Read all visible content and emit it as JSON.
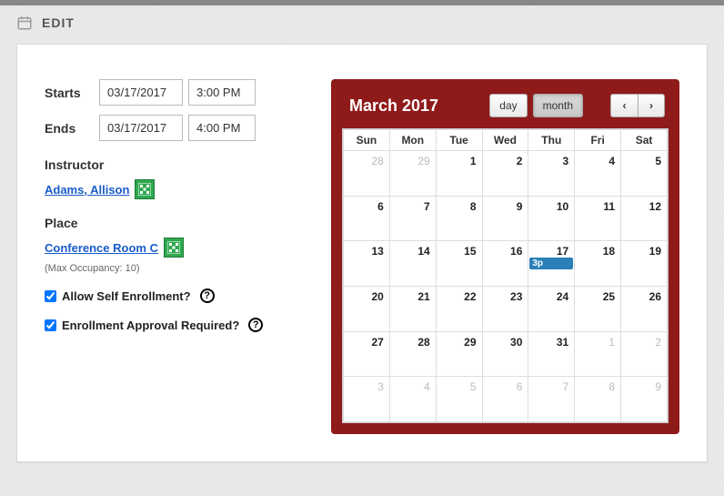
{
  "page": {
    "title": "EDIT"
  },
  "form": {
    "starts_label": "Starts",
    "ends_label": "Ends",
    "start_date": "03/17/2017",
    "start_time": "3:00 PM",
    "end_date": "03/17/2017",
    "end_time": "4:00 PM",
    "instructor_label": "Instructor",
    "instructor_name": "Adams, Allison",
    "place_label": "Place",
    "place_name": "Conference Room C",
    "place_hint": "(Max Occupancy: 10)",
    "allow_self_label": "Allow Self Enrollment?",
    "allow_self_checked": true,
    "approval_label": "Enrollment Approval Required?",
    "approval_checked": true
  },
  "calendar": {
    "title": "March 2017",
    "view_day": "day",
    "view_month": "month",
    "nav_prev": "‹",
    "nav_next": "›",
    "dow": [
      "Sun",
      "Mon",
      "Tue",
      "Wed",
      "Thu",
      "Fri",
      "Sat"
    ],
    "weeks": [
      [
        {
          "d": "28",
          "o": true
        },
        {
          "d": "29",
          "o": true
        },
        {
          "d": "1"
        },
        {
          "d": "2"
        },
        {
          "d": "3"
        },
        {
          "d": "4"
        },
        {
          "d": "5"
        }
      ],
      [
        {
          "d": "6"
        },
        {
          "d": "7"
        },
        {
          "d": "8"
        },
        {
          "d": "9"
        },
        {
          "d": "10"
        },
        {
          "d": "11"
        },
        {
          "d": "12"
        }
      ],
      [
        {
          "d": "13"
        },
        {
          "d": "14"
        },
        {
          "d": "15"
        },
        {
          "d": "16"
        },
        {
          "d": "17",
          "event": "3p"
        },
        {
          "d": "18"
        },
        {
          "d": "19"
        }
      ],
      [
        {
          "d": "20"
        },
        {
          "d": "21"
        },
        {
          "d": "22"
        },
        {
          "d": "23"
        },
        {
          "d": "24"
        },
        {
          "d": "25"
        },
        {
          "d": "26"
        }
      ],
      [
        {
          "d": "27"
        },
        {
          "d": "28"
        },
        {
          "d": "29"
        },
        {
          "d": "30"
        },
        {
          "d": "31"
        },
        {
          "d": "1",
          "o": true
        },
        {
          "d": "2",
          "o": true
        }
      ],
      [
        {
          "d": "3",
          "o": true
        },
        {
          "d": "4",
          "o": true
        },
        {
          "d": "5",
          "o": true
        },
        {
          "d": "6",
          "o": true
        },
        {
          "d": "7",
          "o": true
        },
        {
          "d": "8",
          "o": true
        },
        {
          "d": "9",
          "o": true
        }
      ]
    ]
  }
}
